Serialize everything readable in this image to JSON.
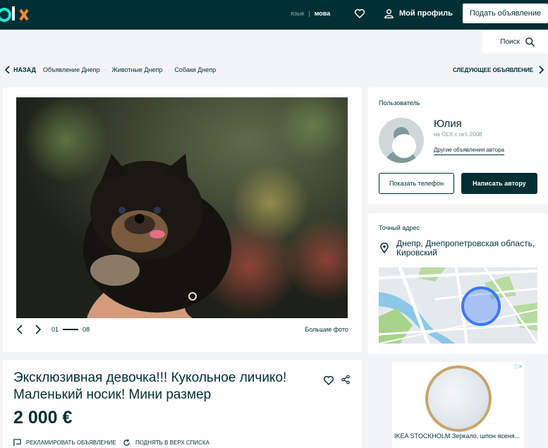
{
  "header": {
    "logo_text": "olx",
    "lang_ru": "язык",
    "lang_sep": "|",
    "lang_ua": "мова",
    "profile_label": "Мой профиль",
    "post_ad_label": "Подать объявление"
  },
  "search": {
    "label": "Поиск"
  },
  "breadcrumb": {
    "back_label": "НАЗАД",
    "items": [
      "Объявление Днепр",
      "Животные Днепр",
      "Собаки Днепр"
    ],
    "next_label": "СЛЕДУЮЩЕЕ ОБЪЯВЛЕНИЕ"
  },
  "gallery": {
    "current": "01",
    "total": "08",
    "big_photo_label": "Большие фото"
  },
  "user": {
    "section_title": "Пользователь",
    "name": "Юлия",
    "since": "на OLX с окт. 2008",
    "other_ads": "Другие объявления автора",
    "show_phone": "Показать телефон",
    "write_author": "Написать автору"
  },
  "location": {
    "section_title": "Точный адрес",
    "address": "Днепр, Днепропетровская область, Кировский"
  },
  "ad": {
    "title": "Эксклюзивная девочка!!! Кукольное личико! Маленький носик! Мини размер",
    "price": "2 000 €",
    "promote_label": "РЕКЛАМИРОВАТЬ ОБЪЯВЛЕНИЕ",
    "raise_label": "ПОДНЯТЬ В ВЕРХ СПИСКА"
  },
  "banner": {
    "caption": "IKEA STOCKHOLM Зеркало, шпон ясеня..."
  },
  "colors": {
    "primary": "#002f34",
    "accent": "#23e5db",
    "background": "#f2f4f5",
    "map_circle": "#3a77ff"
  }
}
